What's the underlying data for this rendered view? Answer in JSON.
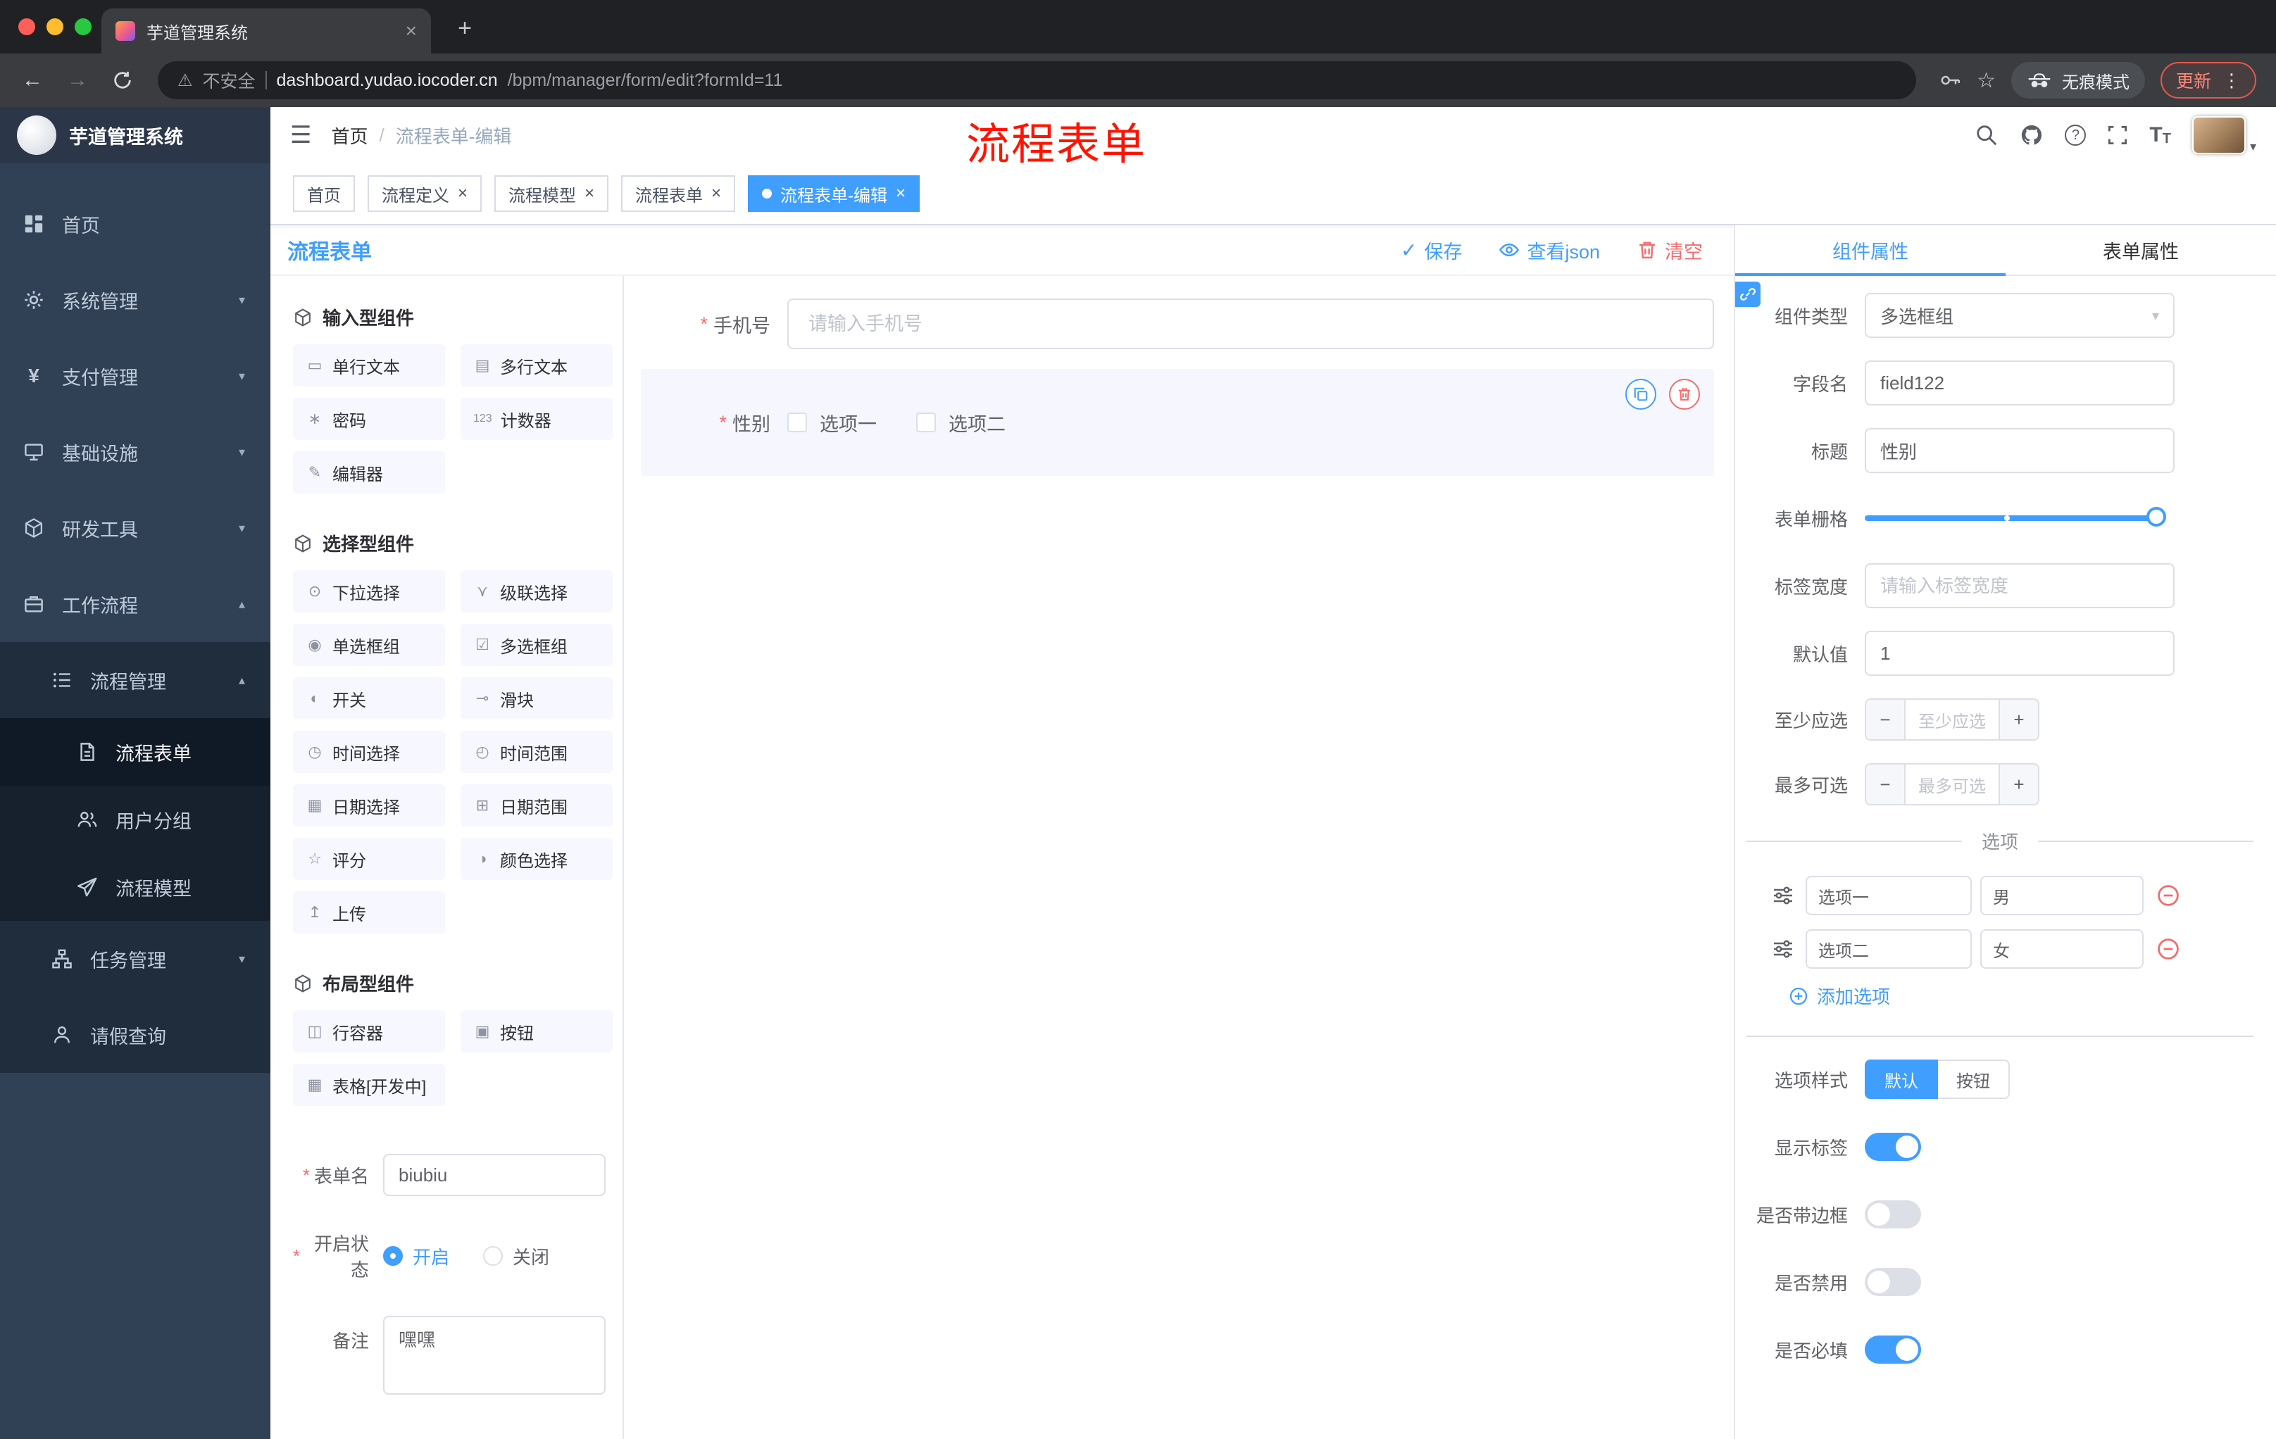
{
  "colors": {
    "accent": "#409eff",
    "danger": "#f56c6c",
    "annotation": "#ff1400",
    "sidebar_bg": "#304156"
  },
  "icons": {
    "close": "×",
    "plus_tab": "+",
    "back": "←",
    "forward": "→",
    "hamburger": "☰",
    "warning": "⚠",
    "star": "☆",
    "menu_dots": "⋮",
    "caret_down": "▾",
    "caret_up": "▴",
    "check": "✓",
    "question": "?",
    "minus": "−",
    "plus": "+",
    "required": "*",
    "font_size": "T",
    "yen": "¥"
  },
  "browser": {
    "tab_title": "芋道管理系统",
    "security_label": "不安全",
    "url_host": "dashboard.yudao.iocoder.cn",
    "url_path": "/bpm/manager/form/edit?formId=11",
    "incognito_label": "无痕模式",
    "update_label": "更新"
  },
  "sidebar": {
    "logo_title": "芋道管理系统",
    "items": [
      {
        "label": "首页"
      },
      {
        "label": "系统管理"
      },
      {
        "label": "支付管理"
      },
      {
        "label": "基础设施"
      },
      {
        "label": "研发工具"
      },
      {
        "label": "工作流程"
      },
      {
        "label": "流程管理"
      },
      {
        "label": "流程表单"
      },
      {
        "label": "用户分组"
      },
      {
        "label": "流程模型"
      },
      {
        "label": "任务管理"
      },
      {
        "label": "请假查询"
      }
    ]
  },
  "header": {
    "breadcrumb": [
      "首页",
      "流程表单-编辑"
    ],
    "breadcrumb_separator": "/",
    "annotation": "流程表单"
  },
  "tags": [
    {
      "label": "首页"
    },
    {
      "label": "流程定义"
    },
    {
      "label": "流程模型"
    },
    {
      "label": "流程表单"
    },
    {
      "label": "流程表单-编辑"
    }
  ],
  "designer": {
    "title": "流程表单",
    "actions": {
      "save": "保存",
      "view_json": "查看json",
      "clear": "清空"
    },
    "left": {
      "sections": [
        {
          "title": "输入型组件",
          "items": [
            {
              "label": "单行文本",
              "icon": "▭"
            },
            {
              "label": "多行文本",
              "icon": "▤"
            },
            {
              "label": "密码",
              "icon": "∗"
            },
            {
              "label": "计数器",
              "icon": "123"
            },
            {
              "label": "编辑器",
              "icon": "✎"
            }
          ]
        },
        {
          "title": "选择型组件",
          "items": [
            {
              "label": "下拉选择",
              "icon": "⊙"
            },
            {
              "label": "级联选择",
              "icon": "⋎"
            },
            {
              "label": "单选框组",
              "icon": "◉"
            },
            {
              "label": "多选框组",
              "icon": "☑"
            },
            {
              "label": "开关",
              "icon": "◐"
            },
            {
              "label": "滑块",
              "icon": "⊸"
            },
            {
              "label": "时间选择",
              "icon": "◷"
            },
            {
              "label": "时间范围",
              "icon": "◴"
            },
            {
              "label": "日期选择",
              "icon": "▦"
            },
            {
              "label": "日期范围",
              "icon": "⊞"
            },
            {
              "label": "评分",
              "icon": "☆"
            },
            {
              "label": "颜色选择",
              "icon": "◑"
            },
            {
              "label": "上传",
              "icon": "↥"
            }
          ]
        },
        {
          "title": "布局型组件",
          "items": [
            {
              "label": "行容器",
              "icon": "◫"
            },
            {
              "label": "按钮",
              "icon": "▣"
            },
            {
              "label": "表格[开发中]",
              "icon": "▦"
            }
          ]
        }
      ],
      "meta": {
        "name_label": "表单名",
        "name_value": "biubiu",
        "status_label": "开启状态",
        "status_on": "开启",
        "status_off": "关闭",
        "remark_label": "备注",
        "remark_value": "嘿嘿"
      }
    },
    "canvas": {
      "phone_label": "手机号",
      "phone_placeholder": "请输入手机号",
      "gender_label": "性别",
      "gender_options": [
        "选项一",
        "选项二"
      ]
    },
    "props": {
      "tabs": [
        "组件属性",
        "表单属性"
      ],
      "rows": {
        "component_type": {
          "label": "组件类型",
          "value": "多选框组"
        },
        "field_name": {
          "label": "字段名",
          "value": "field122"
        },
        "title": {
          "label": "标题",
          "value": "性别"
        },
        "grid": {
          "label": "表单栅格"
        },
        "label_width": {
          "label": "标签宽度",
          "placeholder": "请输入标签宽度"
        },
        "default": {
          "label": "默认值",
          "value": "1"
        },
        "min": {
          "label": "至少应选",
          "placeholder": "至少应选"
        },
        "max": {
          "label": "最多可选",
          "placeholder": "最多可选"
        }
      },
      "options_title": "选项",
      "options": [
        {
          "label": "选项一",
          "value": "男"
        },
        {
          "label": "选项二",
          "value": "女"
        }
      ],
      "add_option": "添加选项",
      "style": {
        "label": "选项样式",
        "choices": [
          "默认",
          "按钮"
        ]
      },
      "switches": [
        {
          "label": "显示标签",
          "on": true
        },
        {
          "label": "是否带边框",
          "on": false
        },
        {
          "label": "是否禁用",
          "on": false
        },
        {
          "label": "是否必填",
          "on": true
        }
      ]
    }
  }
}
